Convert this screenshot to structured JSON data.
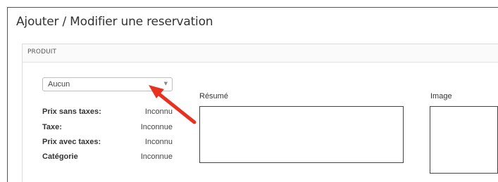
{
  "page": {
    "title": "Ajouter / Modifier une reservation"
  },
  "panel": {
    "heading": "PRODUIT",
    "product_select": {
      "value": "Aucun",
      "caret_icon": "chevron-down-icon"
    },
    "properties": [
      {
        "label": "Prix sans taxes:",
        "value": "Inconnu"
      },
      {
        "label": "Taxe:",
        "value": "Inconnue"
      },
      {
        "label": "Prix avec taxes:",
        "value": "Inconnu"
      },
      {
        "label": "Catégorie",
        "value": "Inconnue"
      }
    ],
    "summary_label": "Résumé",
    "image_label": "Image"
  },
  "annotation": {
    "arrow_color": "#e8311e"
  },
  "colors": {
    "frame_border": "#555555",
    "panel_border": "#dcdcdc",
    "panel_header_bg": "#fafafa"
  }
}
